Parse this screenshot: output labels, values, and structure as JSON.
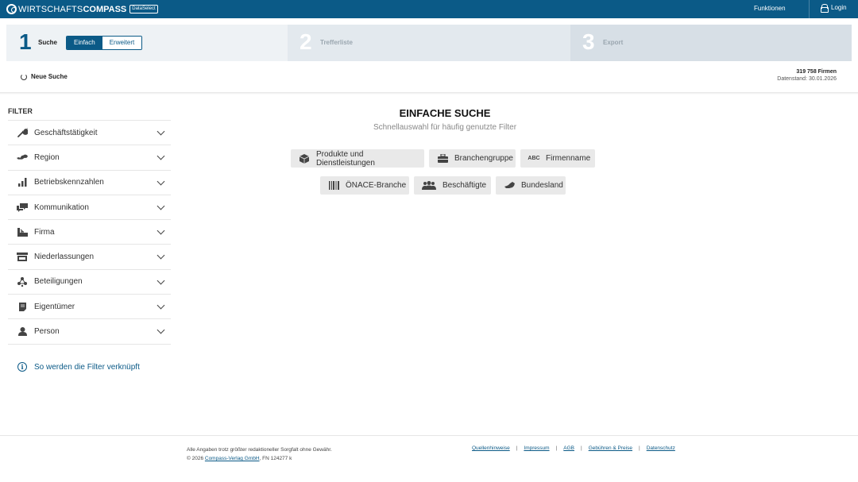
{
  "header": {
    "logo_text_light": "WIRTSCHAFTS",
    "logo_text_bold": "COMPASS",
    "logo_badge": "DataSelect",
    "functions_label": "Funktionen",
    "login_label": "Login",
    "bg_color": "#0b5a87"
  },
  "steps": [
    {
      "number": "1",
      "label": "Suche"
    },
    {
      "number": "2",
      "label": "Trefferliste"
    },
    {
      "number": "3",
      "label": "Export"
    }
  ],
  "mode_toggle": {
    "simple": "Einfach",
    "advanced": "Erweitert",
    "selected": "Einfach"
  },
  "toolbar": {
    "new_search": "Neue Suche"
  },
  "stats": {
    "companies": "319 758 Firmen",
    "data_date": "Datenstand: 30.01.2026"
  },
  "sidebar": {
    "title": "FILTER",
    "items": [
      {
        "label": "Geschäftstätigkeit",
        "icon": "wrench-icon"
      },
      {
        "label": "Region",
        "icon": "region-map-icon"
      },
      {
        "label": "Betriebskennzahlen",
        "icon": "bar-chart-icon"
      },
      {
        "label": "Kommunikation",
        "icon": "chat-bubbles-icon"
      },
      {
        "label": "Firma",
        "icon": "factory-icon"
      },
      {
        "label": "Niederlassungen",
        "icon": "storefront-icon"
      },
      {
        "label": "Beteiligungen",
        "icon": "network-icon"
      },
      {
        "label": "Eigentümer",
        "icon": "document-icon"
      },
      {
        "label": "Person",
        "icon": "person-icon"
      }
    ],
    "help_link": "So werden die Filter verknüpft"
  },
  "main": {
    "title": "EINFACHE SUCHE",
    "subtitle": "Schnellauswahl für häufig genutzte Filter",
    "quick_filters": [
      {
        "label": "Produkte und Dienstleistungen",
        "icon": "package-icon"
      },
      {
        "label": "Branchengruppe",
        "icon": "briefcase-icon"
      },
      {
        "label": "Firmenname",
        "icon": "abc-icon",
        "icon_text": "ABC"
      },
      {
        "label": "ÖNACE-Branche",
        "icon": "barcode-icon"
      },
      {
        "label": "Beschäftigte",
        "icon": "group-icon"
      },
      {
        "label": "Bundesland",
        "icon": "austria-map-icon"
      }
    ]
  },
  "footer": {
    "disclaimer": "Alle Angaben trotz größter redaktioneller Sorgfalt ohne Gewähr.",
    "copyright_prefix": "© 2026 ",
    "company_link": "Compass-Verlag GmbH",
    "copyright_suffix": ", FN 124277 k",
    "links": [
      "Quellenhinweise",
      "Impressum",
      "AGB",
      "Gebühren & Preise",
      "Datenschutz"
    ],
    "separator": "|"
  }
}
